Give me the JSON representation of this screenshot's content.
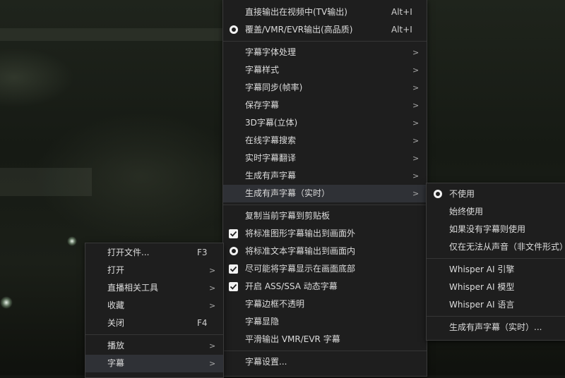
{
  "main_menu": {
    "items": [
      {
        "label": "直接输出在视频中(TV输出)",
        "shortcut": "Alt+I"
      },
      {
        "label": "覆盖/VMR/EVR输出(高品质)",
        "shortcut": "Alt+I",
        "radio": true
      },
      {
        "label": "字幕字体处理",
        "arrow": ">"
      },
      {
        "label": "字幕样式",
        "arrow": ">"
      },
      {
        "label": "字幕同步(帧率)",
        "arrow": ">"
      },
      {
        "label": "保存字幕",
        "arrow": ">"
      },
      {
        "label": "3D字幕(立体)",
        "arrow": ">"
      },
      {
        "label": "在线字幕搜索",
        "arrow": ">"
      },
      {
        "label": "实时字幕翻译",
        "arrow": ">"
      },
      {
        "label": "生成有声字幕",
        "arrow": ">"
      },
      {
        "label": "生成有声字幕（实时）",
        "arrow": ">"
      },
      {
        "label": "复制当前字幕到剪贴板"
      },
      {
        "label": "将标准图形字幕输出到画面外",
        "checked": true
      },
      {
        "label": "将标准文本字幕输出到画面内",
        "radio": true
      },
      {
        "label": "尽可能将字幕显示在画面底部",
        "checked": true
      },
      {
        "label": "开启 ASS/SSA 动态字幕",
        "checked": true
      },
      {
        "label": "字幕边框不透明"
      },
      {
        "label": "字幕显隐"
      },
      {
        "label": "平滑输出 VMR/EVR 字幕"
      },
      {
        "label": "字幕设置..."
      }
    ]
  },
  "left_menu": {
    "items": [
      {
        "label": "打开文件...",
        "shortcut": "F3"
      },
      {
        "label": "打开",
        "arrow": ">"
      },
      {
        "label": "直播相关工具",
        "arrow": ">"
      },
      {
        "label": "收藏",
        "arrow": ">"
      },
      {
        "label": "关闭",
        "shortcut": "F4"
      },
      {
        "label": "播放",
        "arrow": ">"
      },
      {
        "label": "字幕",
        "arrow": ">"
      }
    ]
  },
  "sub_menu": {
    "items": [
      {
        "label": "不使用",
        "radio": true
      },
      {
        "label": "始终使用"
      },
      {
        "label": "如果没有字幕则使用"
      },
      {
        "label": "仅在无法从声音（非文件形式）"
      },
      {
        "label": "Whisper AI 引擎"
      },
      {
        "label": "Whisper AI 模型"
      },
      {
        "label": "Whisper AI 语言"
      },
      {
        "label": "生成有声字幕（实时）..."
      }
    ]
  }
}
